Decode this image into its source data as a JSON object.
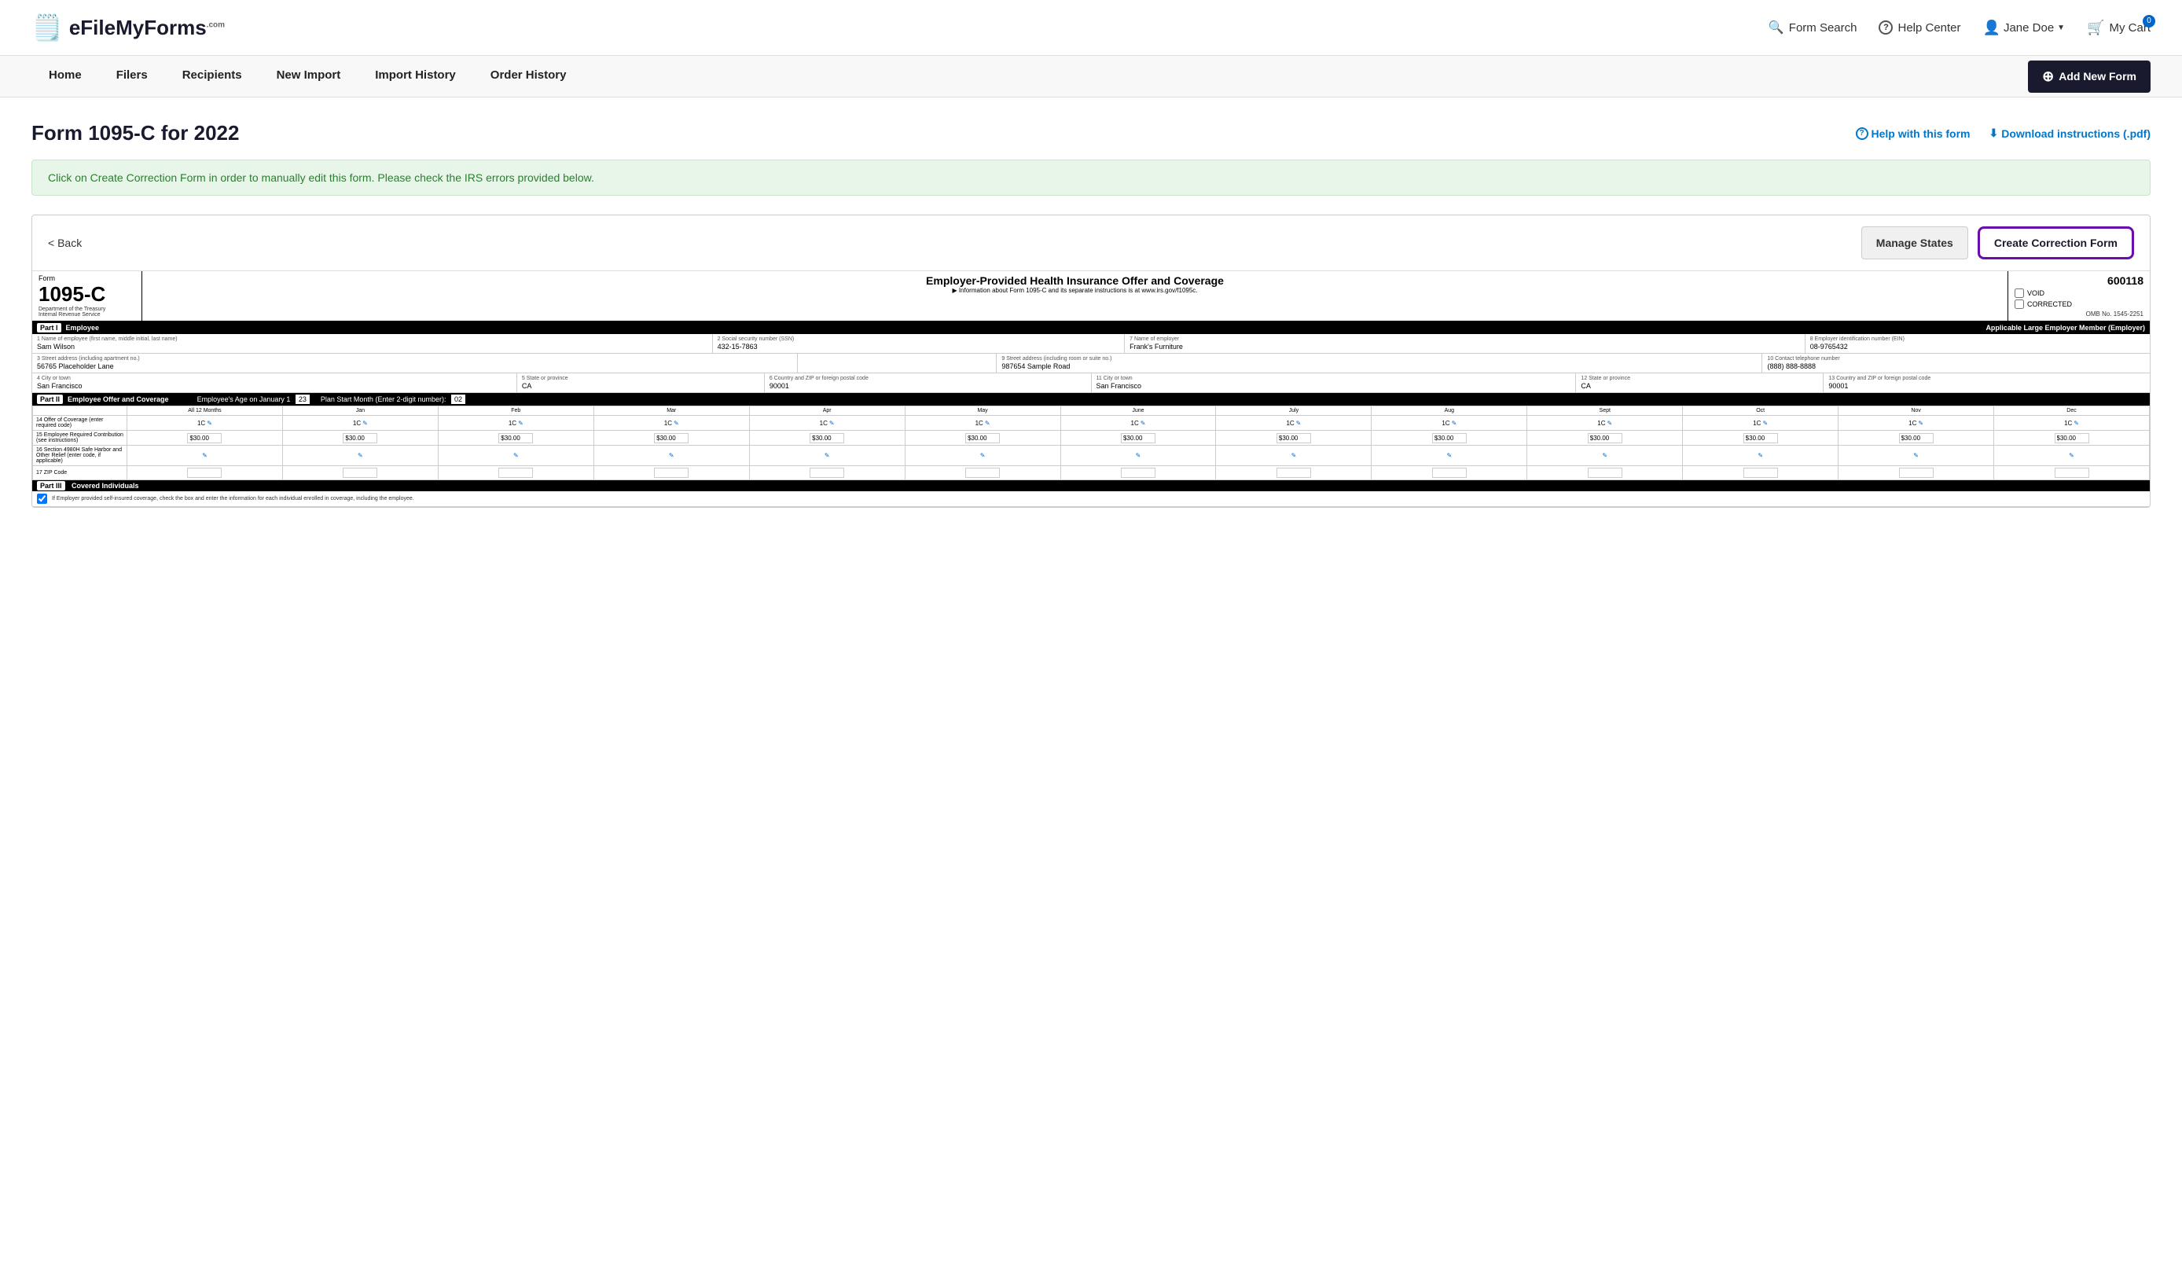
{
  "header": {
    "logo_text_efile": "eFile",
    "logo_text_myforms": "MyForms",
    "logo_text_com": ".com",
    "nav_items": [
      {
        "id": "form-search",
        "label": "Form Search",
        "icon": "search"
      },
      {
        "id": "help-center",
        "label": "Help Center",
        "icon": "question"
      },
      {
        "id": "user",
        "label": "Jane Doe",
        "icon": "person"
      },
      {
        "id": "cart",
        "label": "My Cart",
        "icon": "cart",
        "badge": "0"
      }
    ]
  },
  "navbar": {
    "items": [
      {
        "id": "home",
        "label": "Home"
      },
      {
        "id": "filers",
        "label": "Filers"
      },
      {
        "id": "recipients",
        "label": "Recipients"
      },
      {
        "id": "new-import",
        "label": "New Import"
      },
      {
        "id": "import-history",
        "label": "Import History"
      },
      {
        "id": "order-history",
        "label": "Order History"
      }
    ],
    "add_new_form_label": "Add New Form"
  },
  "page": {
    "title": "Form 1095-C for 2022",
    "help_link": "Help with this form",
    "download_link": "Download instructions (.pdf)",
    "info_banner": "Click on Create Correction Form in order to manually edit this form. Please check the IRS errors provided below."
  },
  "form_card": {
    "back_label": "< Back",
    "manage_states_label": "Manage States",
    "create_correction_label": "Create Correction Form"
  },
  "irs_form": {
    "form_number": "1095-C",
    "department_line1": "Department of the Treasury",
    "department_line2": "Internal Revenue Service",
    "title_main": "Employer-Provided Health Insurance Offer and Coverage",
    "title_sub": "▶ Information about Form 1095-C and its separate instructions is at www.irs.gov/f1095c.",
    "serial_number": "600118",
    "omb_number": "OMB No. 1545-2251",
    "void_label": "VOID",
    "corrected_label": "CORRECTED",
    "part1": {
      "label": "Part I",
      "title": "Employee",
      "right_title": "Applicable Large Employer Member (Employer)",
      "fields": {
        "employee_name_label": "1 Name of employee (first name, middle initial, last name)",
        "employee_name": "Sam Wilson",
        "ssn_label": "2 Social security number (SSN)",
        "ssn": "432-15-7863",
        "employer_name_label": "7 Name of employer",
        "employer_name": "Frank's Furniture",
        "ein_label": "8 Employer identification number (EIN)",
        "ein": "08-9765432",
        "street_label": "3 Street address (including apartment no.)",
        "street": "56765 Placeholder Lane",
        "employer_street_label": "9 Street address (including room or suite no.)",
        "employer_street": "987654 Sample Road",
        "phone_label": "10 Contact telephone number",
        "phone": "(888) 888-8888",
        "city_label": "4 City or town",
        "city": "San Francisco",
        "state_label": "5 State or province",
        "state": "CA",
        "zip_label": "6 Country and ZIP or foreign postal code",
        "zip": "90001",
        "emp_city_label": "11 City or town",
        "emp_city": "San Francisco",
        "emp_state_label": "12 State or province",
        "emp_state": "CA",
        "emp_zip_label": "13 Country and ZIP or foreign postal code",
        "emp_zip": "90001"
      }
    },
    "part2": {
      "label": "Part II",
      "title": "Employee Offer and Coverage",
      "age_label": "Employee's Age on January 1",
      "age_value": "23",
      "plan_month_label": "Plan Start Month (Enter 2-digit number):",
      "plan_month_value": "02",
      "months": [
        "All 12 Months",
        "Jan",
        "Feb",
        "Mar",
        "Apr",
        "May",
        "June",
        "July",
        "Aug",
        "Sept",
        "Oct",
        "Nov",
        "Dec"
      ],
      "row14_label": "14 Offer of Coverage (enter required code)",
      "row14_code": "1C",
      "row15_label": "15 Employee Required Contribution (see instructions)",
      "row15_value": "$30.00",
      "row16_label": "16 Section 4980H Safe Harbor and Other Relief (enter code, if applicable)",
      "row17_label": "17 ZIP Code"
    },
    "part3": {
      "label": "Part III",
      "title": "Covered Individuals",
      "sub": "If Employer provided self-insured coverage, check the box and enter the information for each individual enrolled in coverage, including the employee."
    }
  }
}
